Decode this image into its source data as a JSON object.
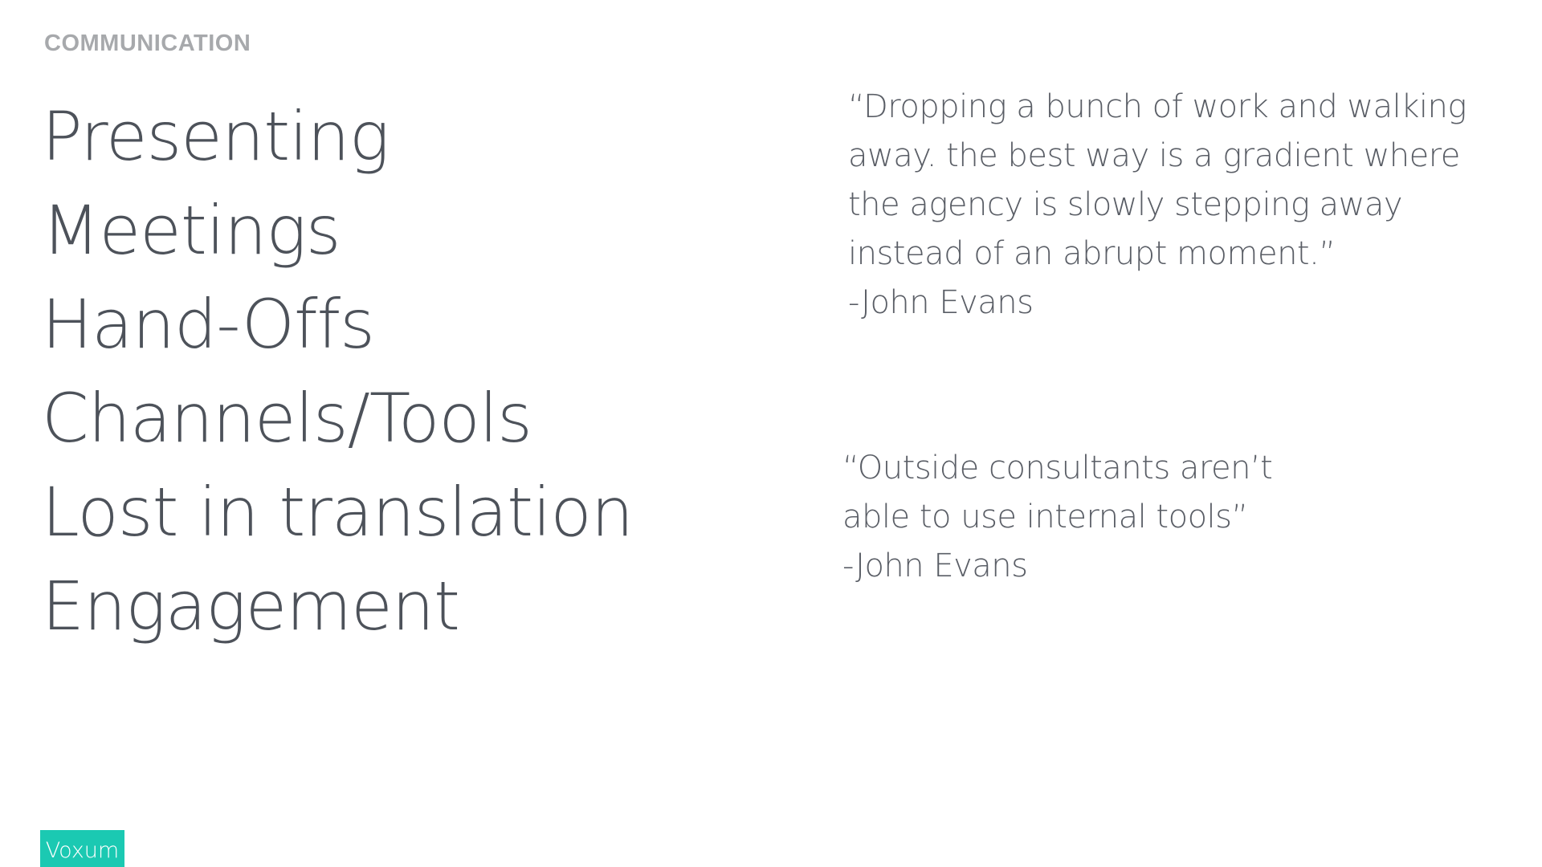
{
  "slide": {
    "section_label": "COMMUNICATION",
    "topics": [
      "Presenting",
      "Meetings",
      "Hand-Offs",
      "Channels/Tools",
      "Lost in translation",
      "Engagement"
    ],
    "quotes": [
      {
        "lines": [
          "“Dropping a bunch of work and walking",
          "away. the best way is a gradient where",
          "the agency is slowly stepping away",
          "instead of an abrupt moment.”"
        ],
        "attribution": "-John Evans"
      },
      {
        "lines": [
          "“Outside consultants aren’t",
          "able to use internal tools”"
        ],
        "attribution": "-John Evans"
      }
    ],
    "brand": "Voxum"
  },
  "colors": {
    "heading_gray": "#a7a9ac",
    "text": "#4d525a",
    "brand_teal": "#1bc9b2"
  }
}
